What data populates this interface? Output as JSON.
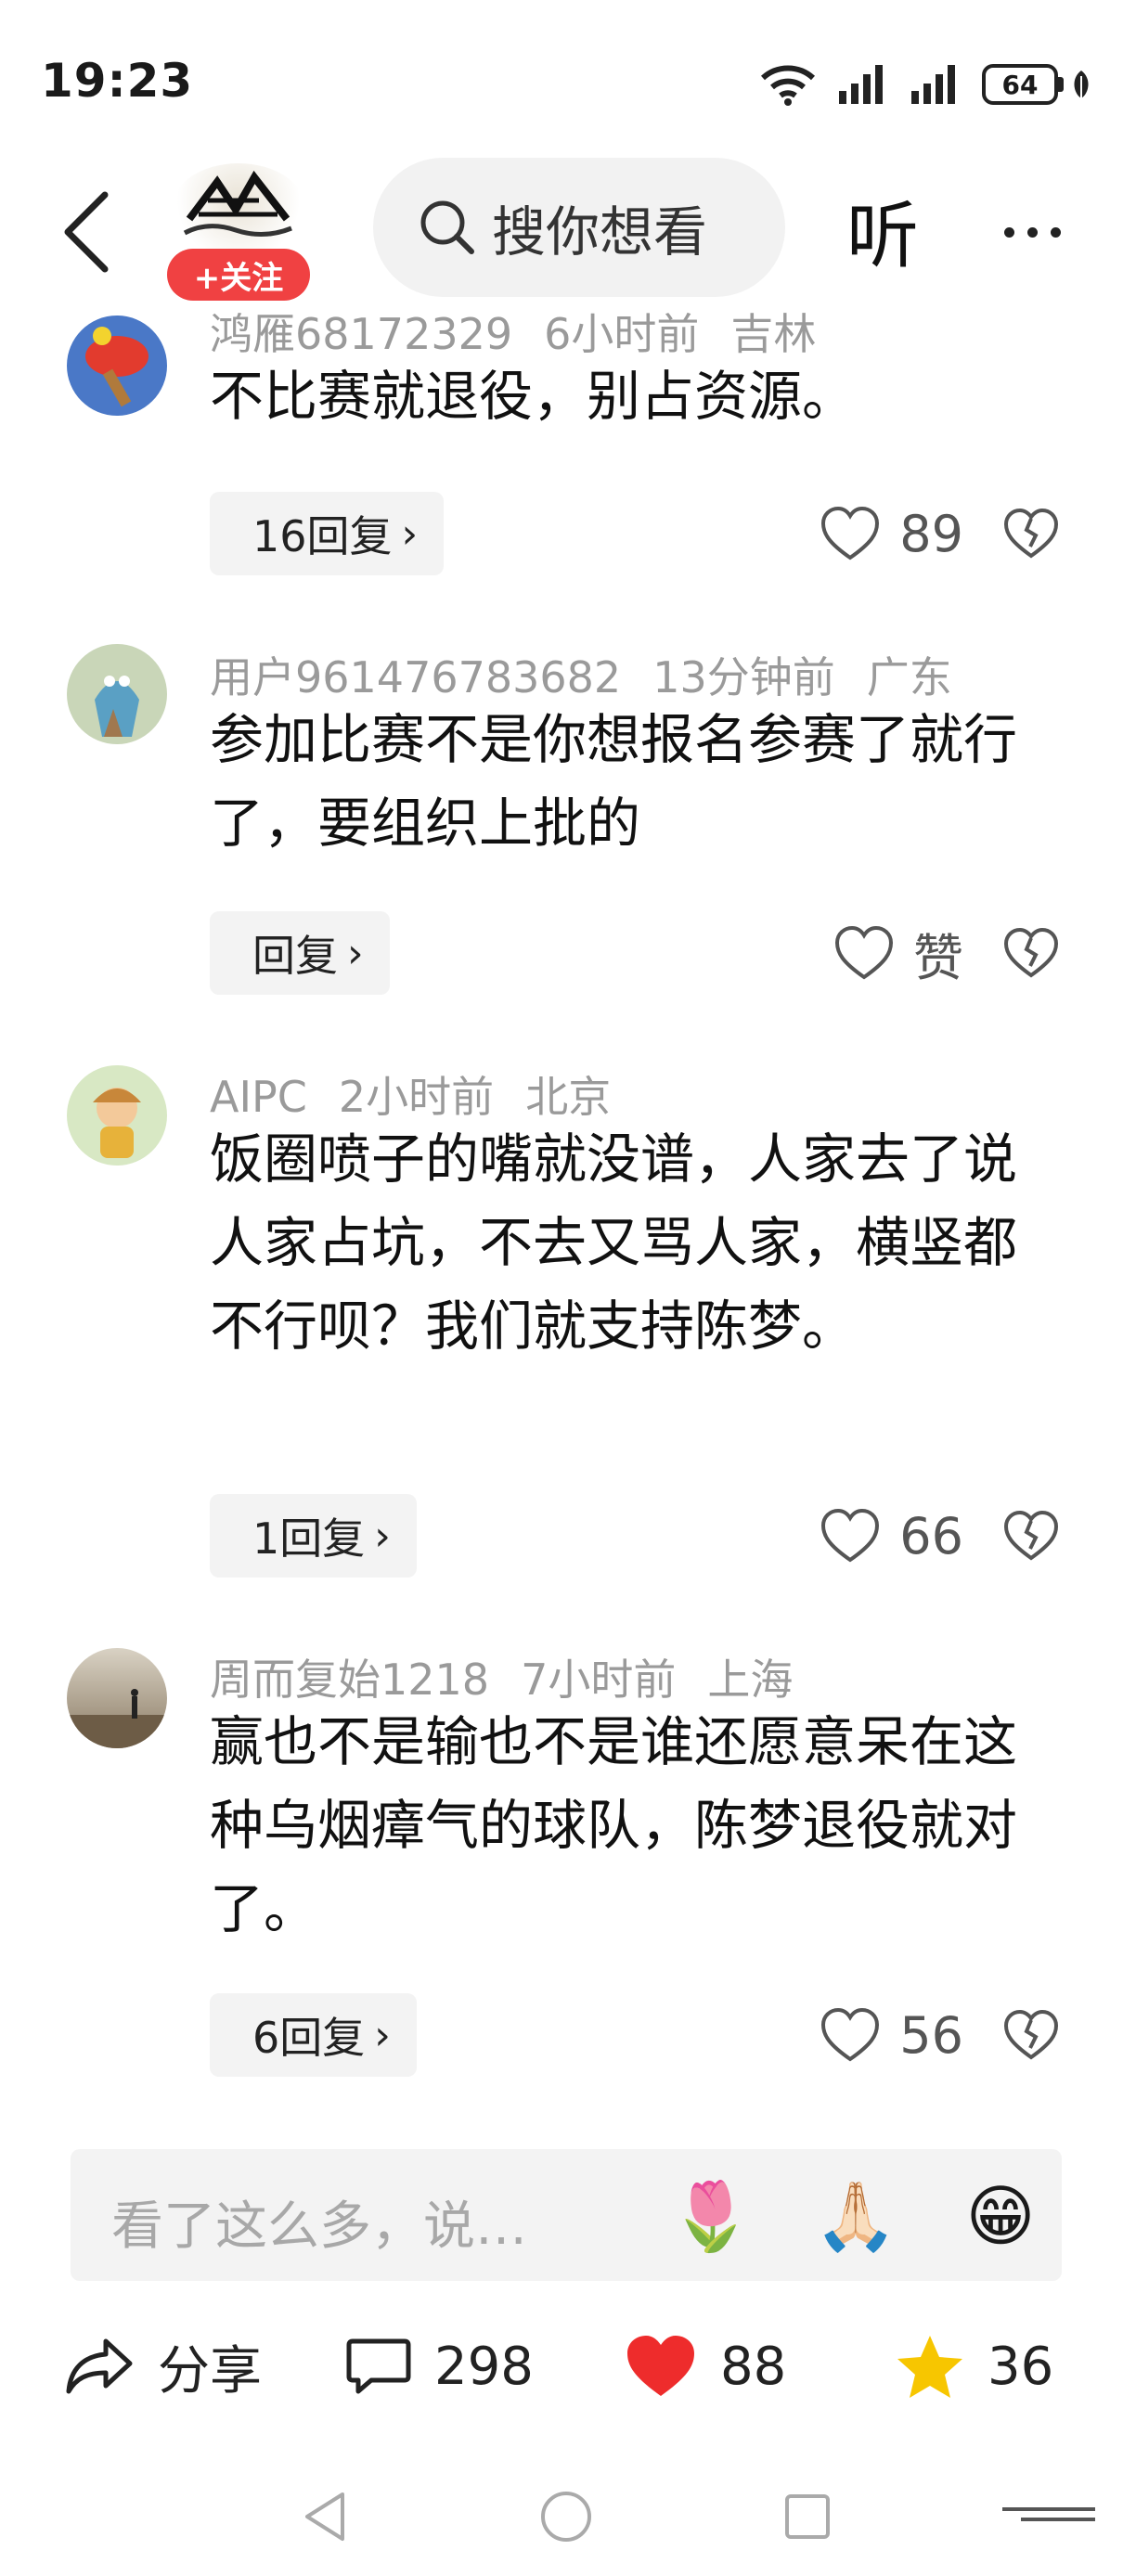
{
  "status_bar": {
    "time": "19:23",
    "battery": "64"
  },
  "header": {
    "follow_label": "+关注",
    "search_placeholder": "搜你想看",
    "listen_label": "听"
  },
  "comments": [
    {
      "username": "鸿雁68172329",
      "time": "6小时前",
      "location": "吉林",
      "text": "不比赛就退役，别占资源。",
      "reply_label": "16回复",
      "likes": "89"
    },
    {
      "username": "用户961476783682",
      "time": "13分钟前",
      "location": "广东",
      "text": "参加比赛不是你想报名参赛了就行了，要组织上批的",
      "reply_label": "回复",
      "likes": "赞"
    },
    {
      "username": "AIPC",
      "time": "2小时前",
      "location": "北京",
      "text": "饭圈喷子的嘴就没谱，人家去了说人家占坑，不去又骂人家，横竖都不行呗？我们就支持陈梦。",
      "reply_label": "1回复",
      "likes": "66"
    },
    {
      "username": "周而复始1218",
      "time": "7小时前",
      "location": "上海",
      "text": "赢也不是输也不是谁还愿意呆在这种乌烟瘴气的球队，陈梦退役就对了。",
      "reply_label": "6回复",
      "likes": "56"
    }
  ],
  "input": {
    "placeholder": "看了这么多，说…",
    "emojis": [
      "🌷",
      "🙏🏻",
      "😁"
    ]
  },
  "actions": {
    "share_label": "分享",
    "comments_count": "298",
    "likes_count": "88",
    "favorites_count": "36"
  },
  "colors": {
    "accent_red": "#f04142",
    "heart_red": "#ee2c2c",
    "star_yellow": "#f7c600"
  }
}
